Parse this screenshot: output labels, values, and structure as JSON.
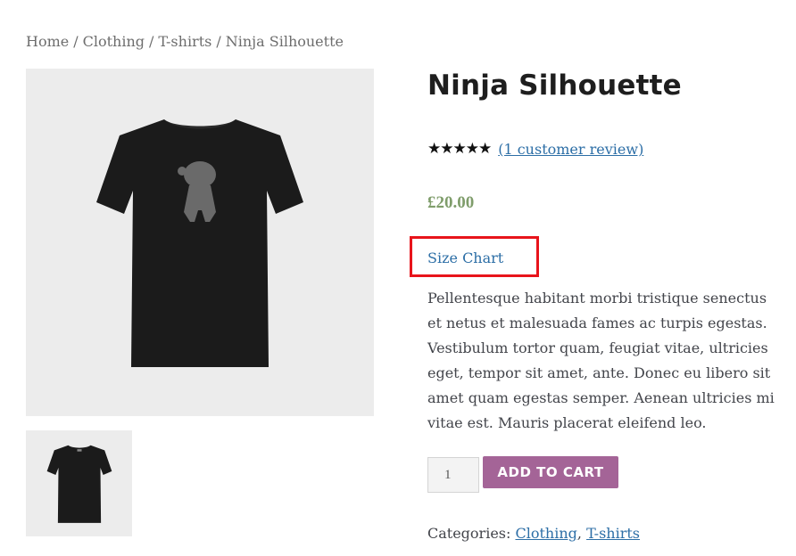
{
  "breadcrumb": {
    "home": "Home",
    "clothing": "Clothing",
    "tshirts": "T-shirts",
    "current": "Ninja Silhouette",
    "separator": "/"
  },
  "product": {
    "title": "Ninja Silhouette",
    "rating": {
      "stars": "★★★★★",
      "value": 5,
      "max": 5,
      "review_link": "(1 customer review)"
    },
    "price": "£20.00",
    "size_chart": "Size Chart",
    "description": "Pellentesque habitant morbi tristique senectus et netus et malesuada fames ac turpis egestas. Vestibulum tortor quam, feugiat vitae, ultricies eget, tempor sit amet, ante. Donec eu libero sit amet quam egestas semper. Aenean ultricies mi vitae est. Mauris placerat eleifend leo.",
    "quantity": "1",
    "add_to_cart": "ADD TO CART",
    "categories": {
      "label": "Categories:",
      "items": [
        "Clothing",
        "T-shirts"
      ],
      "separator": ","
    }
  },
  "colors": {
    "accent_button": "#a46497",
    "price": "#7f9d6b",
    "link": "#2c6ea6",
    "highlight_box": "#e8141b"
  }
}
